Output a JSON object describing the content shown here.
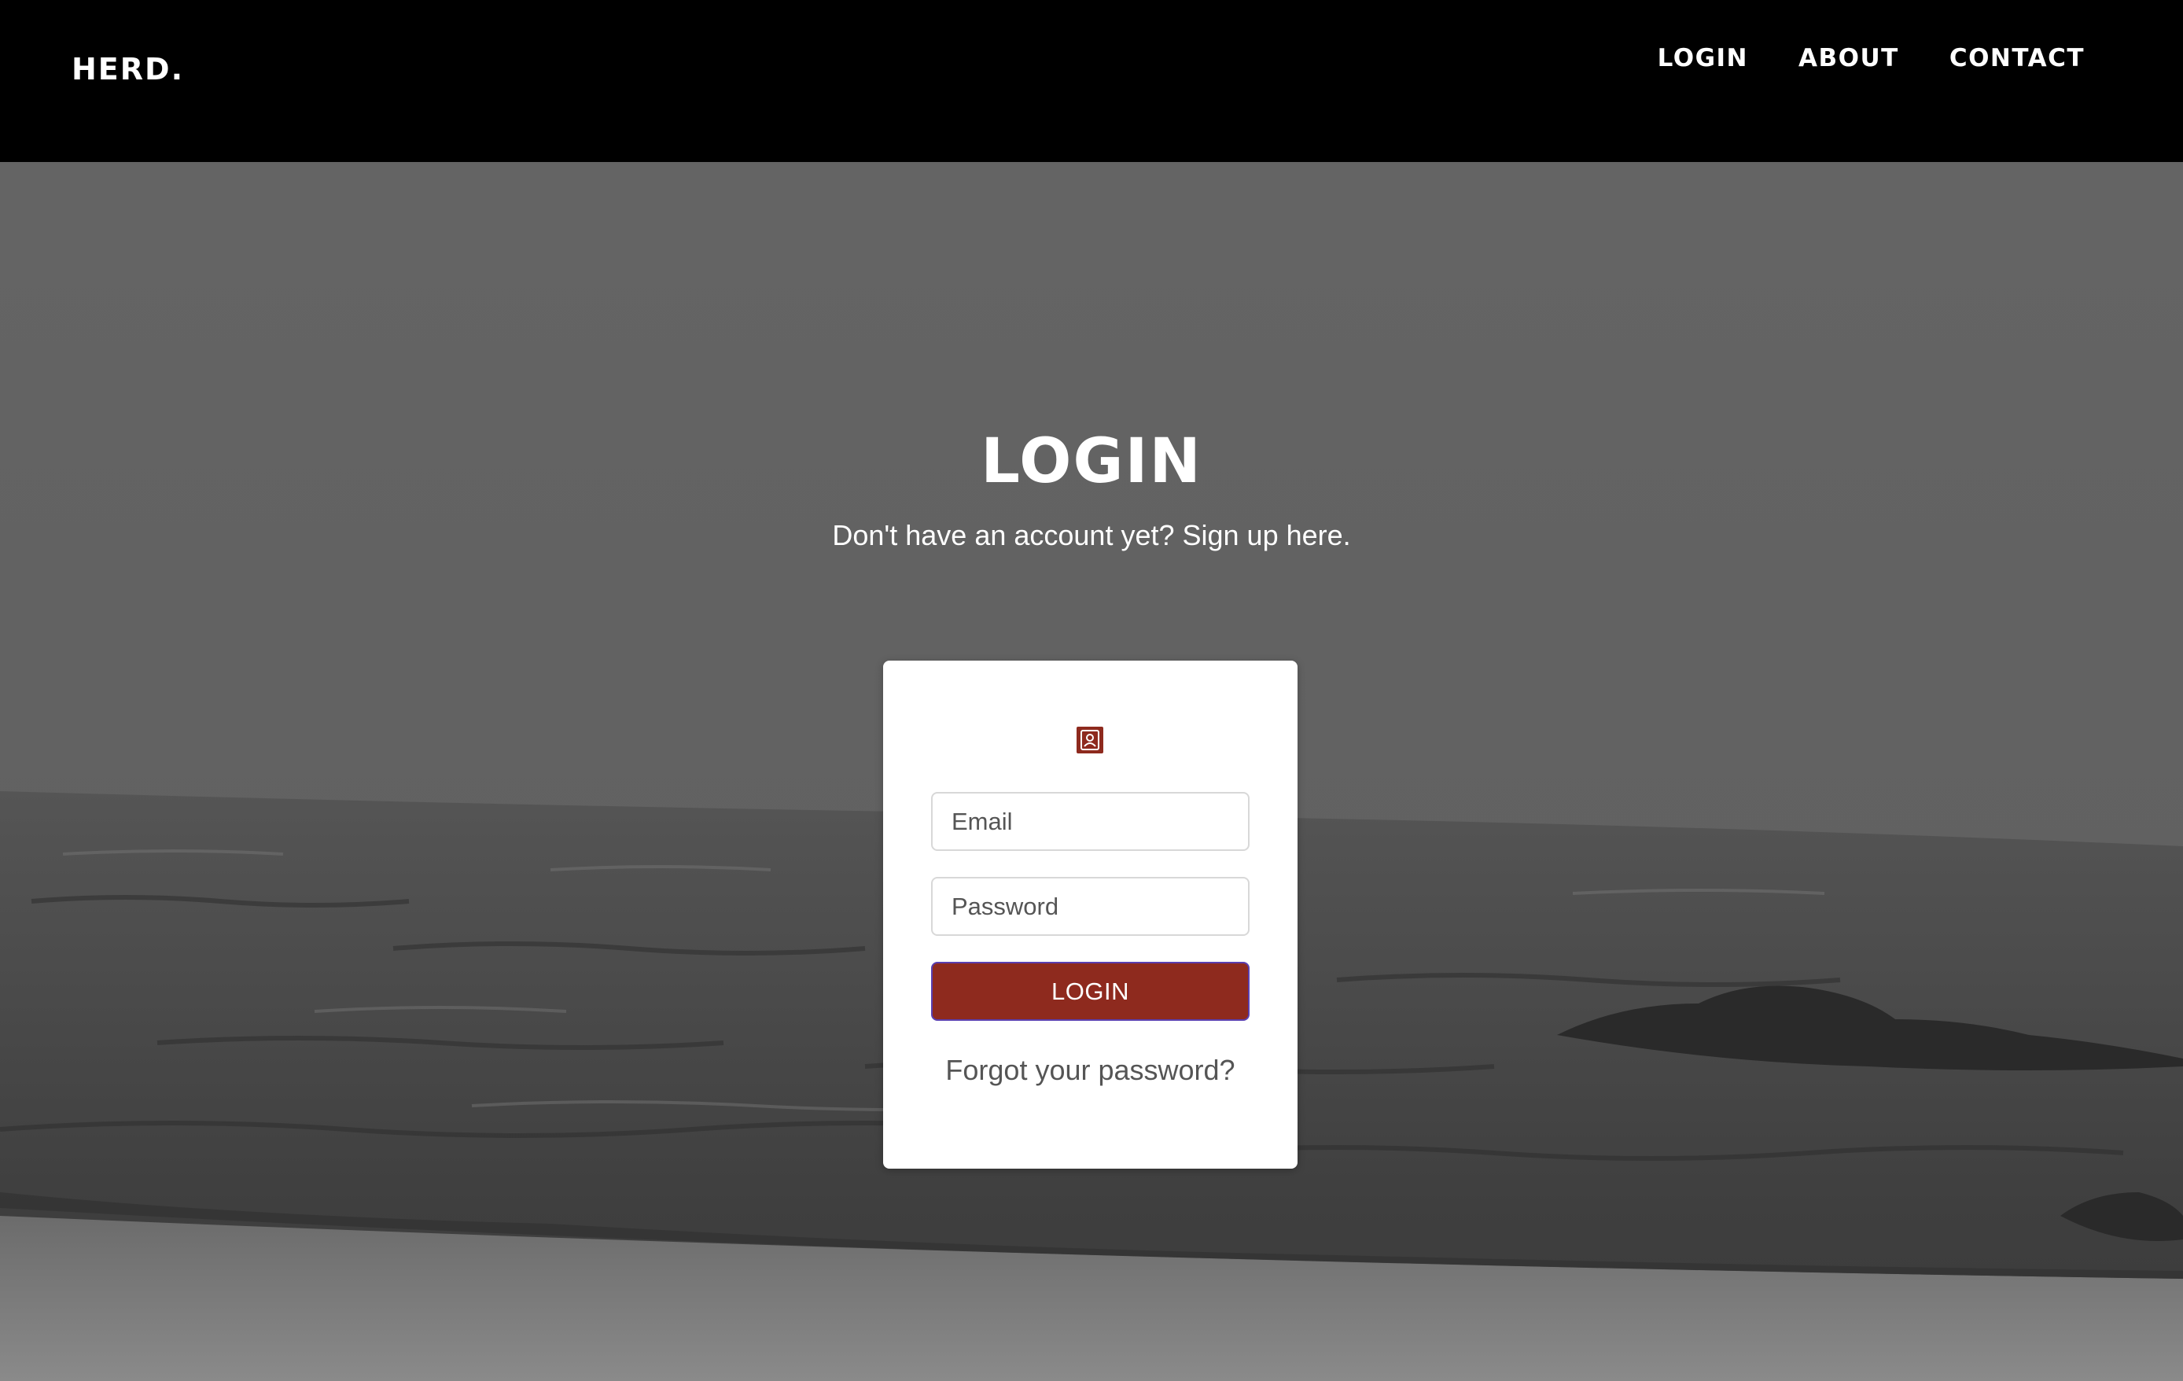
{
  "navbar": {
    "brand": "HERD.",
    "links": [
      {
        "label": "LOGIN"
      },
      {
        "label": "ABOUT"
      },
      {
        "label": "CONTACT"
      }
    ]
  },
  "hero": {
    "title": "LOGIN",
    "signup_prefix": "Don't have an account yet? ",
    "signup_link": "Sign up here."
  },
  "form": {
    "email_placeholder": "Email",
    "email_value": "",
    "password_placeholder": "Password",
    "password_value": "",
    "submit_label": "LOGIN",
    "forgot_label": "Forgot your password?",
    "icon": "user-profile-icon"
  },
  "colors": {
    "nav_background": "#000000",
    "accent": "#8e2a1e",
    "button_border": "#5a3fb0",
    "card_background": "#ffffff",
    "text_light": "#ffffff",
    "text_muted": "#555555"
  }
}
